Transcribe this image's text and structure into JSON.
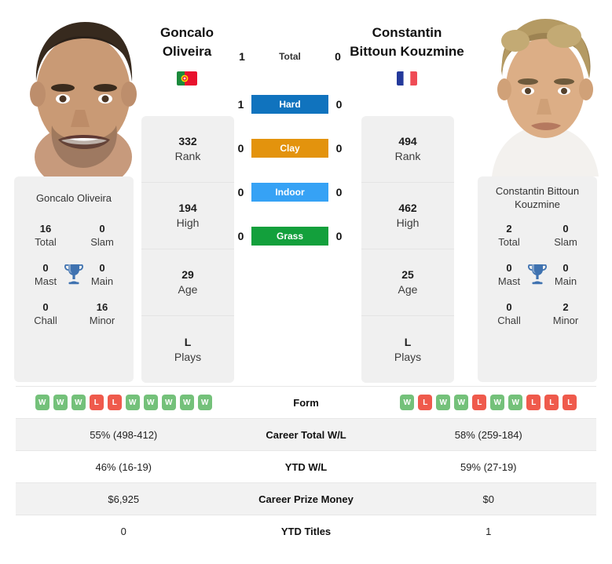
{
  "players": {
    "left": {
      "name": "Goncalo Oliveira",
      "name_line1": "Goncalo",
      "name_line2": "Oliveira",
      "flag": "portugal-flag",
      "titles": {
        "total": "16",
        "total_label": "Total",
        "slam": "0",
        "slam_label": "Slam",
        "mast": "0",
        "mast_label": "Mast",
        "main": "0",
        "main_label": "Main",
        "chall": "0",
        "chall_label": "Chall",
        "minor": "16",
        "minor_label": "Minor"
      },
      "stats": [
        {
          "value": "332",
          "label": "Rank"
        },
        {
          "value": "194",
          "label": "High"
        },
        {
          "value": "29",
          "label": "Age"
        },
        {
          "value": "L",
          "label": "Plays"
        }
      ],
      "form": [
        "W",
        "W",
        "W",
        "L",
        "L",
        "W",
        "W",
        "W",
        "W",
        "W"
      ],
      "career_total_wl": "55% (498-412)",
      "ytd_wl": "46% (16-19)",
      "career_prize_money": "$6,925",
      "ytd_titles": "0"
    },
    "right": {
      "name": "Constantin Bittoun Kouzmine",
      "name_line1": "Constantin",
      "name_line2": "Bittoun Kouzmine",
      "flag": "france-flag",
      "titles": {
        "total": "2",
        "total_label": "Total",
        "slam": "0",
        "slam_label": "Slam",
        "mast": "0",
        "mast_label": "Mast",
        "main": "0",
        "main_label": "Main",
        "chall": "0",
        "chall_label": "Chall",
        "minor": "2",
        "minor_label": "Minor"
      },
      "stats": [
        {
          "value": "494",
          "label": "Rank"
        },
        {
          "value": "462",
          "label": "High"
        },
        {
          "value": "25",
          "label": "Age"
        },
        {
          "value": "L",
          "label": "Plays"
        }
      ],
      "form": [
        "W",
        "L",
        "W",
        "W",
        "L",
        "W",
        "W",
        "L",
        "L",
        "L"
      ],
      "career_total_wl": "58% (259-184)",
      "ytd_wl": "59% (27-19)",
      "career_prize_money": "$0",
      "ytd_titles": "1"
    }
  },
  "h2h": {
    "total": {
      "label": "Total",
      "left": "1",
      "right": "0"
    },
    "surfaces": [
      {
        "label": "Hard",
        "left": "1",
        "right": "0",
        "color": "#1073be"
      },
      {
        "label": "Clay",
        "left": "0",
        "right": "0",
        "color": "#e3930d"
      },
      {
        "label": "Indoor",
        "left": "0",
        "right": "0",
        "color": "#36a2f5"
      },
      {
        "label": "Grass",
        "left": "0",
        "right": "0",
        "color": "#13a03c"
      }
    ]
  },
  "table": {
    "rows": [
      {
        "label": "Form",
        "type": "form"
      },
      {
        "label": "Career Total W/L",
        "type": "text",
        "left_key": "career_total_wl",
        "right_key": "career_total_wl"
      },
      {
        "label": "YTD W/L",
        "type": "text",
        "left_key": "ytd_wl",
        "right_key": "ytd_wl"
      },
      {
        "label": "Career Prize Money",
        "type": "text",
        "left_key": "career_prize_money",
        "right_key": "career_prize_money"
      },
      {
        "label": "YTD Titles",
        "type": "text",
        "left_key": "ytd_titles",
        "right_key": "ytd_titles"
      }
    ]
  },
  "colors": {
    "card_bg": "#f0f0f0",
    "row_alt": "#f2f2f2",
    "win_badge": "#74c17a",
    "loss_badge": "#ef5a4c",
    "trophy": "#3f72b0"
  }
}
